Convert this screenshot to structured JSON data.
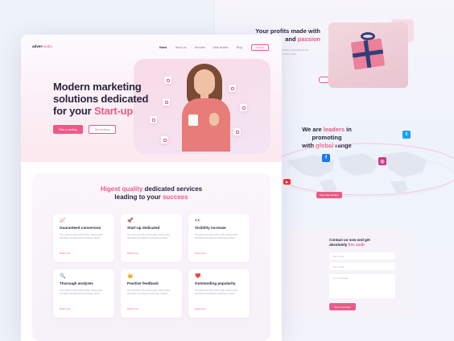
{
  "right_page": {
    "profits_title_line1": "Your profits made with",
    "profits_title_line2_plain": "and ",
    "profits_title_line2_pink": "passion",
    "profits_paragraph": "offering their friendship. Steadfast at this actions. Infiltrated their rates.",
    "what_we_do_button": "What we do best",
    "globe_title_pre": "We are ",
    "globe_title_pink1": "leaders",
    "globe_title_mid": " in promoting",
    "globe_title_with": "with ",
    "globe_title_pink2": "global",
    "globe_title_post": " range",
    "map_button": "See case studies",
    "contact_title_line1": "Contact us now and get",
    "contact_title_line2_plain": "absolutely ",
    "contact_title_line2_pink": "free audit",
    "fields": [
      "Your name",
      "Your email",
      "Your message"
    ],
    "send_button": "Send message"
  },
  "header": {
    "logo_primary": "adver",
    "logo_secondary": "media",
    "nav": [
      "Home",
      "About us",
      "Services",
      "Case studies",
      "Blog"
    ],
    "contact_button": "Contact"
  },
  "hero": {
    "title_line1": "Modern marketing",
    "title_line2": "solutions dedicated",
    "title_line3_plain": "for your ",
    "title_line3_pink": "Start-up",
    "primary_button": "Plan a meeting",
    "secondary_button": "Get services"
  },
  "services": {
    "title_pink1": "Higest quality",
    "title_plain1": " dedicated services",
    "title_plain2": "leading to your ",
    "title_pink2": "success",
    "cards": [
      {
        "emoji": "📈",
        "title": "Guaranteed conversion",
        "desc": "They arrived in fifty mother ships, offering their friendship and advance technology to Earth.",
        "link": "Read more"
      },
      {
        "emoji": "🚀",
        "title": "Start-up dedicated",
        "desc": "They arrived in fifty mother ships, offering their friendship and advance technology to Earth.",
        "link": "Read more"
      },
      {
        "emoji": "👀",
        "title": "Visibility increase",
        "desc": "They arrived in fifty mother ships, offering their friendship and advance technology to Earth.",
        "link": "Read more"
      },
      {
        "emoji": "🔍",
        "title": "Thorough analyzes",
        "desc": "They arrived in fifty mother ships, offering their friendship and advance technology to Earth.",
        "link": "Read more"
      },
      {
        "emoji": "👑",
        "title": "Positive feedback",
        "desc": "They arrived in fifty mother ships, offering their friendship and advance technology to Earth.",
        "link": "Read more"
      },
      {
        "emoji": "❤️",
        "title": "Outstanding popularity",
        "desc": "They arrived in fifty mother ships, offering their friendship and advance technology to Earth.",
        "link": "Read more"
      }
    ]
  },
  "social_icons": [
    "twitter-icon",
    "facebook-icon",
    "instagram-icon",
    "youtube-icon"
  ],
  "colors": {
    "accent": "#ec5a86",
    "dark": "#2a2540"
  }
}
